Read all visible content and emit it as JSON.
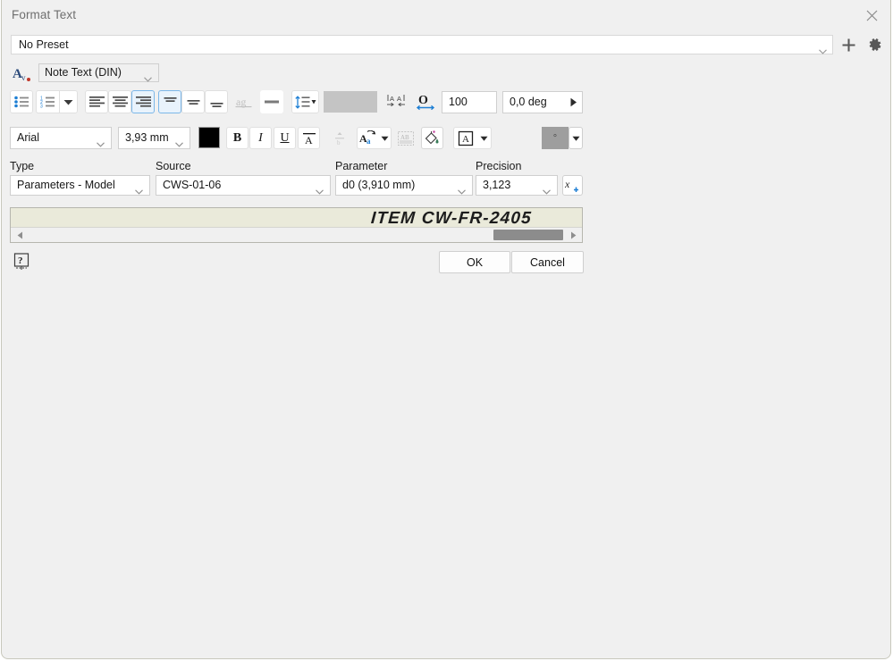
{
  "window": {
    "title": "Format Text",
    "close_icon": "close-icon",
    "background_color": "#f0f0f0"
  },
  "preset": {
    "value": "No Preset",
    "dropdown_icon": "chevron-down-icon",
    "add_icon": "plus-icon",
    "settings_icon": "gear-icon"
  },
  "style": {
    "icon": "text-style-icon",
    "value": "Note Text (DIN)",
    "dropdown_icon": "chevron-down-icon"
  },
  "paragraph_toolbar": {
    "buttons": [
      {
        "name": "bulleted-list-button",
        "icon": "bulleted-list-icon",
        "selected": false,
        "enabled": true
      },
      {
        "name": "numbered-list-button",
        "icon": "numbered-list-icon",
        "selected": false,
        "enabled": true
      },
      {
        "name": "list-options-dropdown",
        "icon": "caret-down-icon",
        "selected": false,
        "enabled": true
      },
      {
        "name": "align-left-button",
        "icon": "align-left-icon",
        "selected": false,
        "enabled": true
      },
      {
        "name": "align-center-button",
        "icon": "align-center-icon",
        "selected": false,
        "enabled": true
      },
      {
        "name": "align-right-button",
        "icon": "align-right-icon",
        "selected": true,
        "enabled": true
      },
      {
        "name": "align-top-button",
        "icon": "align-top-icon",
        "selected": true,
        "enabled": true
      },
      {
        "name": "align-middle-button",
        "icon": "align-middle-icon",
        "selected": false,
        "enabled": true
      },
      {
        "name": "align-bottom-button",
        "icon": "align-bottom-icon",
        "selected": false,
        "enabled": true
      },
      {
        "name": "strikethrough-button",
        "icon": "strikethrough-ag-icon",
        "selected": false,
        "enabled": false
      },
      {
        "name": "horizontal-rule-button",
        "icon": "horizontal-line-icon",
        "selected": false,
        "enabled": true
      },
      {
        "name": "line-spacing-button",
        "icon": "line-spacing-icon",
        "selected": false,
        "enabled": true
      }
    ],
    "line_spacing_value": "",
    "character_spacing_icon": "character-spacing-icon",
    "stretch_icon": "text-stretch-icon",
    "stretch_value": "100",
    "angle_value": "0,0 deg",
    "expand_icon": "expand-arrow-icon"
  },
  "font_toolbar": {
    "font_family": "Arial",
    "font_size": "3,93 mm",
    "color_swatch": "#000000",
    "bold_label": "B",
    "italic_label": "I",
    "underline_label": "U",
    "buttons": [
      {
        "name": "bold-button",
        "icon": "bold-icon",
        "enabled": true
      },
      {
        "name": "italic-button",
        "icon": "italic-icon",
        "enabled": true
      },
      {
        "name": "underline-button",
        "icon": "underline-icon",
        "enabled": true
      },
      {
        "name": "overline-button",
        "icon": "overline-icon",
        "enabled": true
      },
      {
        "name": "fraction-stack-button",
        "icon": "fraction-stack-icon",
        "enabled": false
      },
      {
        "name": "text-case-button",
        "icon": "text-case-icon",
        "enabled": true
      },
      {
        "name": "text-mask-button",
        "icon": "text-mask-icon",
        "enabled": false
      },
      {
        "name": "text-fill-button",
        "icon": "paint-bucket-icon",
        "enabled": true
      },
      {
        "name": "text-frame-button",
        "icon": "boxed-text-icon",
        "enabled": true
      }
    ],
    "symbol_value": "°",
    "symbol_dropdown_icon": "caret-down-icon"
  },
  "parameters": {
    "type": {
      "label": "Type",
      "value": "Parameters - Model"
    },
    "source": {
      "label": "Source",
      "value": "CWS-01-06"
    },
    "parameter": {
      "label": "Parameter",
      "value": "d0 (3,910 mm)"
    },
    "precision": {
      "label": "Precision",
      "value": "3,123"
    },
    "insert_button": {
      "name": "insert-parameter-button",
      "icon": "insert-variable-icon"
    }
  },
  "editor": {
    "text": "ITEM CW-FR-2405",
    "background_color": "#eaeada",
    "scrollbar": {
      "left_arrow_icon": "scroll-left-icon",
      "right_arrow_icon": "scroll-right-icon"
    }
  },
  "footer": {
    "help_icon": "help-question-icon",
    "ok_label": "OK",
    "cancel_label": "Cancel"
  }
}
